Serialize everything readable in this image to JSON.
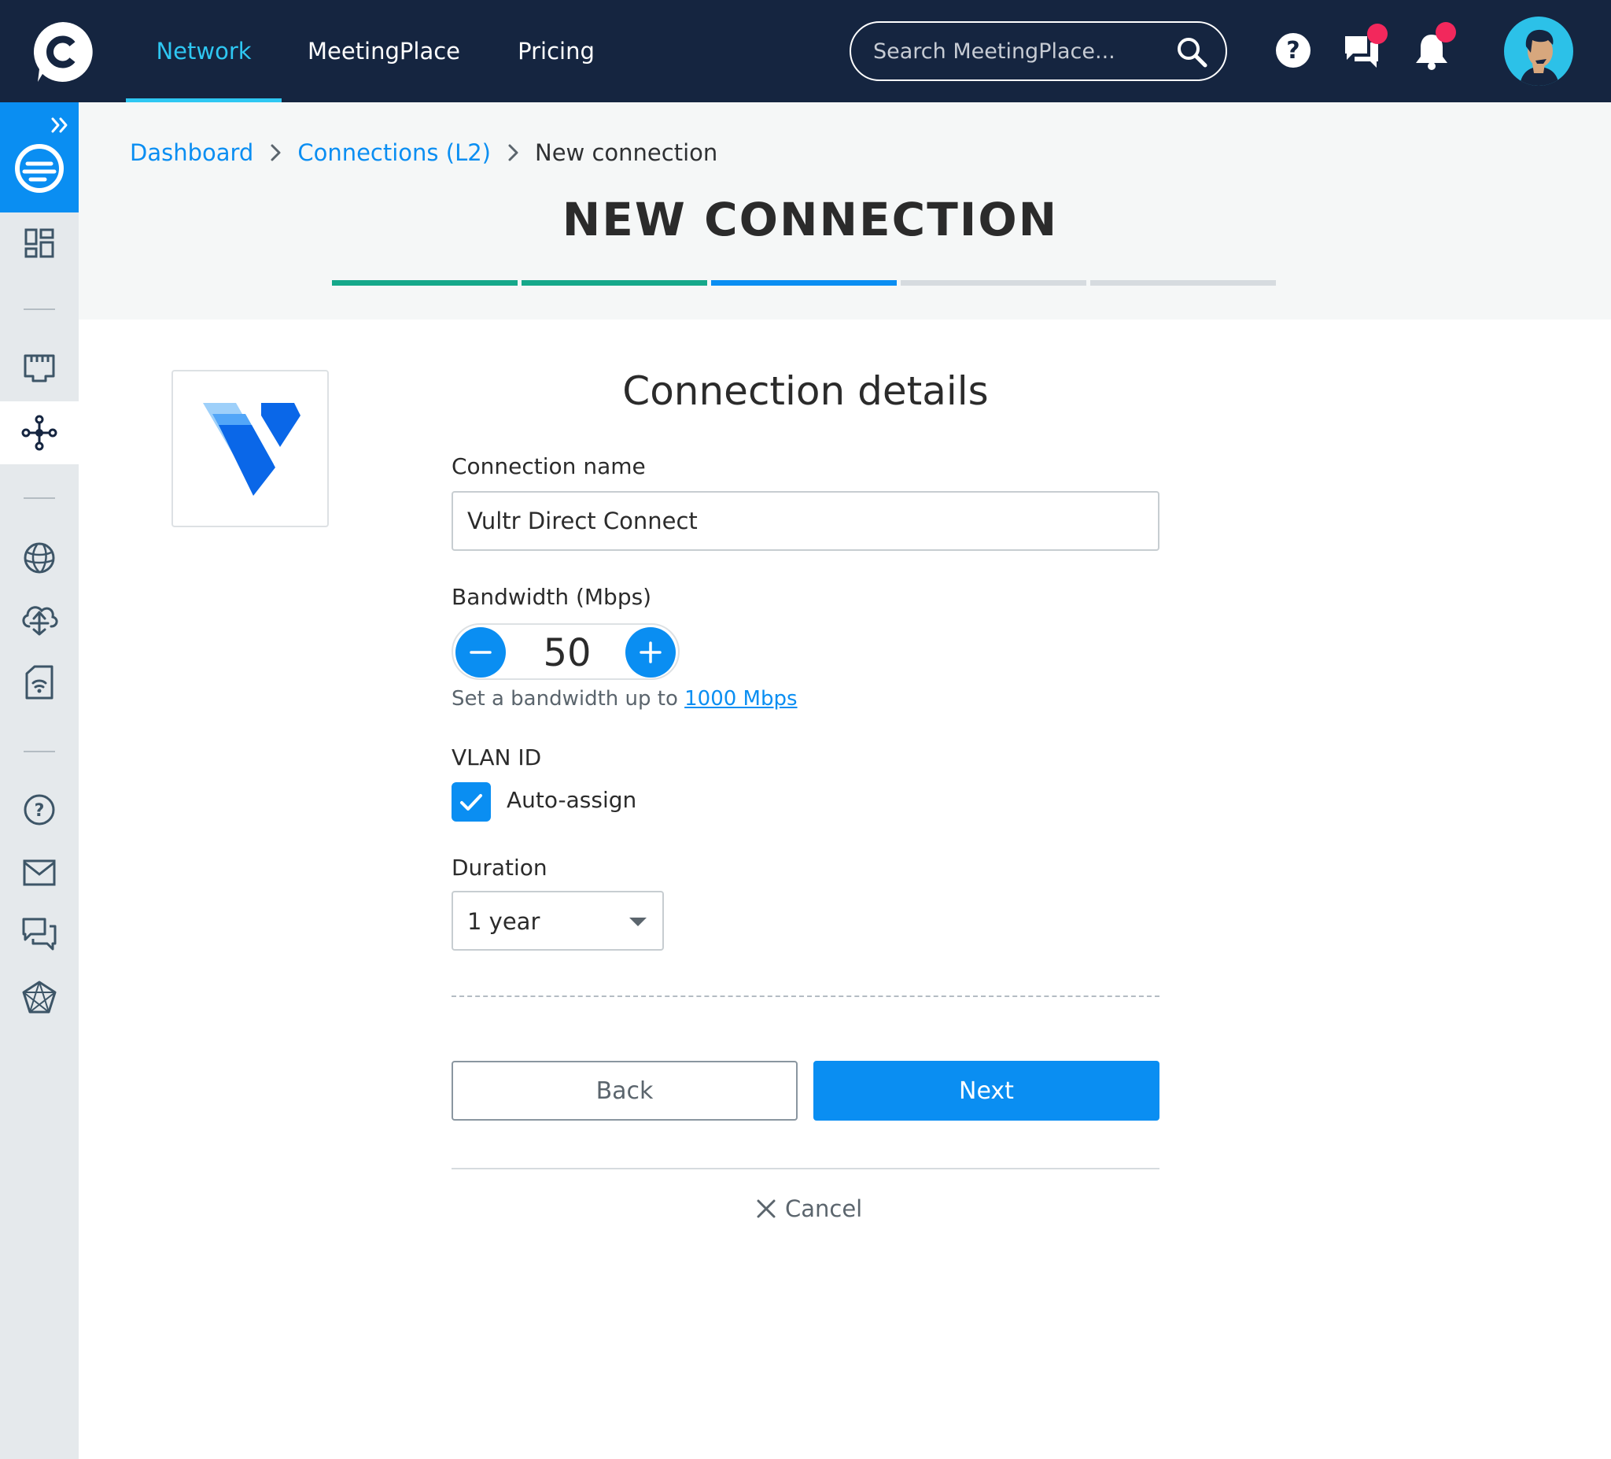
{
  "topbar": {
    "nav": [
      {
        "label": "Network",
        "active": true
      },
      {
        "label": "MeetingPlace",
        "active": false
      },
      {
        "label": "Pricing",
        "active": false
      }
    ],
    "search_placeholder": "Search MeetingPlace...",
    "icons": [
      "help-icon",
      "chat-icon",
      "bell-icon"
    ],
    "accent": "#2ec7f2",
    "background": "#152540"
  },
  "sidebar": {
    "items": [
      "expand-icon",
      "brand-icon",
      "dashboard-icon",
      "ports-icon",
      "connections-icon",
      "internet-icon",
      "cloud-icon",
      "devices-icon",
      "help-icon",
      "mail-icon",
      "chat-icon",
      "network-icon"
    ],
    "active": "connections-icon"
  },
  "breadcrumb": {
    "items": [
      "Dashboard",
      "Connections (L2)"
    ],
    "current": "New connection"
  },
  "page": {
    "title": "NEW CONNECTION",
    "steps": [
      {
        "state": "complete",
        "color": "#15a88a"
      },
      {
        "state": "complete",
        "color": "#15a88a"
      },
      {
        "state": "current",
        "color": "#0a8ef2"
      },
      {
        "state": "pending",
        "color": "#d6dbdf"
      },
      {
        "state": "pending",
        "color": "#d6dbdf"
      }
    ]
  },
  "provider": {
    "logo": "vultr-logo"
  },
  "form": {
    "section_title": "Connection details",
    "name_label": "Connection name",
    "name_value": "Vultr Direct Connect",
    "bandwidth_label": "Bandwidth (Mbps)",
    "bandwidth_value": "50",
    "bandwidth_hint": "Set a bandwidth up to",
    "bandwidth_max": "1000 Mbps",
    "vlan_label": "VLAN ID",
    "auto_assign_label": "Auto-assign",
    "auto_assign_checked": true,
    "duration_label": "Duration",
    "duration_value": "1 year",
    "back_label": "Back",
    "next_label": "Next",
    "cancel_label": "Cancel"
  },
  "colors": {
    "primary": "#0a8ef2",
    "complete": "#15a88a",
    "notification": "#f2285c"
  }
}
